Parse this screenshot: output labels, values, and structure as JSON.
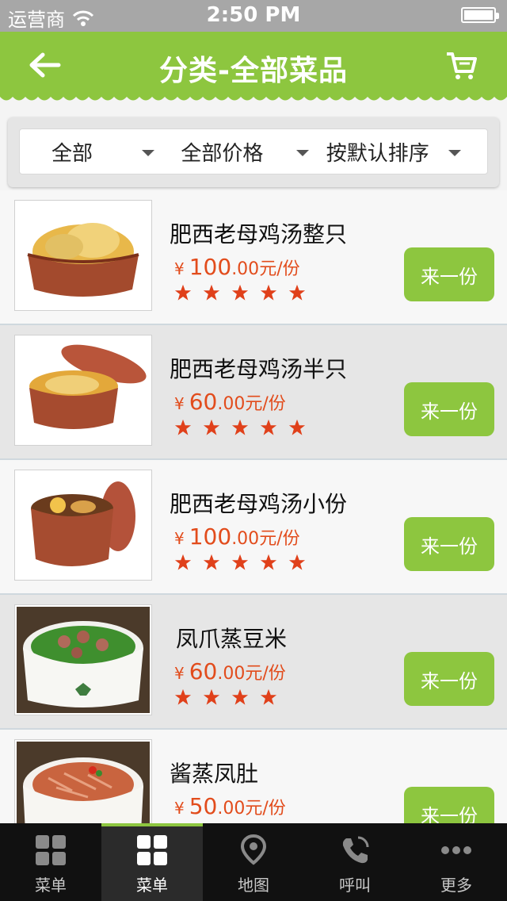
{
  "status_bar": {
    "carrier": "运营商",
    "time": "2:50 PM"
  },
  "header": {
    "title": "分类-全部菜品",
    "back_icon": "back-arrow-icon",
    "cart_icon": "cart-icon"
  },
  "filters": [
    {
      "label": "全部"
    },
    {
      "label": "全部价格"
    },
    {
      "label": "按默认排序"
    }
  ],
  "dishes": [
    {
      "name": "肥西老母鸡汤整只",
      "yen": "¥",
      "price_int": "100",
      "price_dec": ".00",
      "unit": "元/份",
      "rating": 5,
      "button": "来一份"
    },
    {
      "name": "肥西老母鸡汤半只",
      "yen": "¥",
      "price_int": "60",
      "price_dec": ".00",
      "unit": "元/份",
      "rating": 5,
      "button": "来一份"
    },
    {
      "name": "肥西老母鸡汤小份",
      "yen": "¥",
      "price_int": "100",
      "price_dec": ".00",
      "unit": "元/份",
      "rating": 5,
      "button": "来一份"
    },
    {
      "name": "凤爪蒸豆米",
      "yen": "¥",
      "price_int": "60",
      "price_dec": ".00",
      "unit": "元/份",
      "rating": 4,
      "button": "来一份"
    },
    {
      "name": "酱蒸凤肚",
      "yen": "¥",
      "price_int": "50",
      "price_dec": ".00",
      "unit": "元/份",
      "rating": 0,
      "button": "来一份"
    }
  ],
  "tabbar": [
    {
      "label": "菜单",
      "icon": "grid-icon",
      "active": false
    },
    {
      "label": "菜单",
      "icon": "grid-icon",
      "active": true
    },
    {
      "label": "地图",
      "icon": "map-pin-icon",
      "active": false
    },
    {
      "label": "呼叫",
      "icon": "phone-icon",
      "active": false
    },
    {
      "label": "更多",
      "icon": "more-dots-icon",
      "active": false
    }
  ],
  "colors": {
    "brand_green": "#8dc63f",
    "price_red": "#e24c1c",
    "star_red": "#e0401a",
    "tabbar_bg": "#111111"
  }
}
